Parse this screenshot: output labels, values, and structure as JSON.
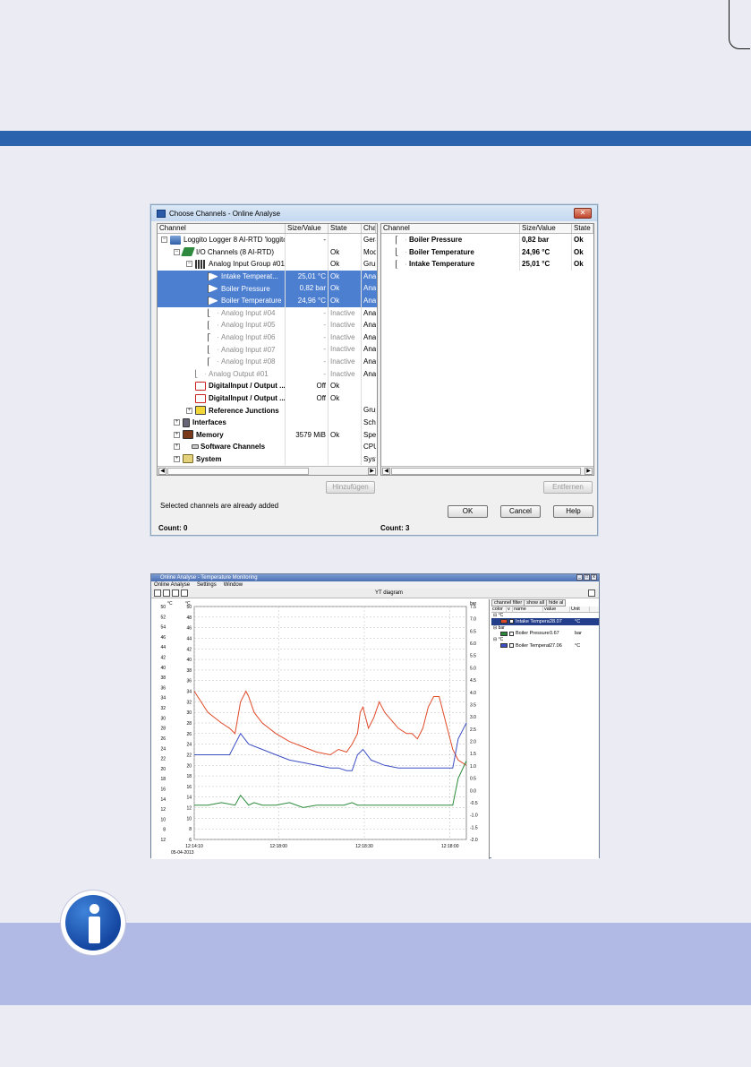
{
  "dialog": {
    "title": "Choose Channels - Online Analyse",
    "close_label": "✕",
    "left": {
      "headers": [
        "Channel",
        "Size/Value",
        "State",
        "Chan"
      ],
      "rows": [
        {
          "label": "Loggito Logger 8 AI-RTD 'loggito-l...",
          "value": "-",
          "state": "",
          "type": "Gerä",
          "indent": 0,
          "icon": "module-icon",
          "exp": "⊟"
        },
        {
          "label": "I/O Channels (8 AI-RTD)",
          "value": "",
          "state": "Ok",
          "type": "Mod",
          "indent": 1,
          "icon": "io-channels-icon",
          "exp": "⊟"
        },
        {
          "label": "Analog Input Group #01",
          "value": "",
          "state": "Ok",
          "type": "Grup",
          "indent": 2,
          "icon": "input-group-icon",
          "exp": "⊟"
        },
        {
          "label": "Intake Temperat...",
          "value": "25,01 °C",
          "state": "Ok",
          "type": "Anal",
          "indent": 3,
          "icon": "analog-input-icon",
          "sel": true
        },
        {
          "label": "Boiler Pressure",
          "value": "0,82 bar",
          "state": "Ok",
          "type": "Anal",
          "indent": 3,
          "icon": "analog-input-icon",
          "sel": true
        },
        {
          "label": "Boiler Temperature",
          "value": "24,96 °C",
          "state": "Ok",
          "type": "Anal",
          "indent": 3,
          "icon": "analog-input-icon",
          "sel": true
        },
        {
          "label": "Analog Input #04",
          "value": "-",
          "state": "Inactive",
          "type": "Anal",
          "indent": 3,
          "icon": "analog-input-icon",
          "gray": true
        },
        {
          "label": "Analog Input #05",
          "value": "-",
          "state": "Inactive",
          "type": "Anal",
          "indent": 3,
          "icon": "analog-input-icon",
          "gray": true
        },
        {
          "label": "Analog Input #06",
          "value": "-",
          "state": "Inactive",
          "type": "Anal",
          "indent": 3,
          "icon": "analog-input-icon",
          "gray": true
        },
        {
          "label": "Analog Input #07",
          "value": "-",
          "state": "Inactive",
          "type": "Anal",
          "indent": 3,
          "icon": "analog-input-icon",
          "gray": true
        },
        {
          "label": "Analog Input #08",
          "value": "-",
          "state": "Inactive",
          "type": "Anal",
          "indent": 3,
          "icon": "analog-input-icon",
          "gray": true
        },
        {
          "label": "Analog Output #01",
          "value": "-",
          "state": "Inactive",
          "type": "Anal",
          "indent": 2,
          "icon": "analog-output-icon",
          "gray": true
        },
        {
          "label": "DigitalInput / Output ...",
          "value": "Off",
          "state": "Ok",
          "type": "",
          "indent": 2,
          "icon": "digital-io-icon",
          "bold": true
        },
        {
          "label": "DigitalInput / Output ...",
          "value": "Off",
          "state": "Ok",
          "type": "",
          "indent": 2,
          "icon": "digital-io-icon",
          "bold": true
        },
        {
          "label": "Reference Junctions",
          "value": "",
          "state": "",
          "type": "Grup",
          "indent": 2,
          "icon": "reference-junction-icon",
          "exp": "⊞",
          "bold": true
        },
        {
          "label": "Interfaces",
          "value": "",
          "state": "",
          "type": "Schr",
          "indent": 1,
          "icon": "interfaces-icon",
          "exp": "⊞",
          "bold": true
        },
        {
          "label": "Memory",
          "value": "3579 MiB",
          "state": "Ok",
          "type": "Spei",
          "indent": 1,
          "icon": "memory-icon",
          "exp": "⊞",
          "bold": true
        },
        {
          "label": "Software Channels",
          "value": "",
          "state": "",
          "type": "CPU",
          "indent": 1,
          "icon": "software-channels-icon",
          "exp": "⊞",
          "bold": true
        },
        {
          "label": "System",
          "value": "",
          "state": "",
          "type": "Syst",
          "indent": 1,
          "icon": "system-icon",
          "exp": "⊞",
          "bold": true
        }
      ],
      "add_button": "Hinzufügen",
      "status": "Selected channels are already added",
      "count": "Count: 0"
    },
    "right": {
      "headers": [
        "Channel",
        "Size/Value",
        "State"
      ],
      "rows": [
        {
          "label": "Boiler Pressure",
          "value": "0,82 bar",
          "state": "Ok"
        },
        {
          "label": "Boiler Temperature",
          "value": "24,96 °C",
          "state": "Ok"
        },
        {
          "label": "Intake Temperature",
          "value": "25,01 °C",
          "state": "Ok"
        }
      ],
      "remove_button": "Entfernen",
      "count": "Count: 3"
    },
    "buttons": {
      "ok": "OK",
      "cancel": "Cancel",
      "help": "Help"
    }
  },
  "window": {
    "title": "Online Analyse - Temperature Monitoring",
    "menu": [
      "Online Analyse",
      "Settings",
      "Window"
    ],
    "diagram_title": "YT diagram",
    "side_tabs": [
      "channel filter",
      "show all",
      "hide al"
    ],
    "side_headers": [
      "color",
      "v",
      "name",
      "value",
      "Unit"
    ],
    "side_groups": [
      {
        "unit": "°C",
        "rows": [
          {
            "name": "Intake Temperature",
            "value": "28.07",
            "unit": "°C",
            "color": "#e04a2a",
            "sel": true
          }
        ]
      },
      {
        "unit": "bar",
        "rows": [
          {
            "name": "Boiler Pressure",
            "value": "0.67",
            "unit": "bar",
            "color": "#2a8a3a"
          }
        ]
      },
      {
        "unit": "°C",
        "rows": [
          {
            "name": "Boiler Temperature",
            "value": "27.06",
            "unit": "°C",
            "color": "#3d4fc4"
          }
        ]
      }
    ],
    "axis_units": {
      "left_outer": "°C",
      "left_inner": "°C",
      "right": "bar"
    },
    "date_label": "05-04-2013"
  },
  "chart_data": {
    "type": "line",
    "x_ticks": [
      "12:14:10",
      "12:18:00",
      "12:18:30",
      "12:18:00"
    ],
    "y_left_outer_ticks": [
      "50",
      "52",
      "54",
      "46",
      "44",
      "42",
      "40",
      "38",
      "36",
      "34",
      "32",
      "30",
      "28",
      "26",
      "24",
      "22",
      "20",
      "18",
      "16",
      "14",
      "12",
      "10",
      "8",
      "12"
    ],
    "y_left_inner_ticks": [
      "50",
      "48",
      "46",
      "44",
      "42",
      "40",
      "38",
      "36",
      "34",
      "32",
      "30",
      "28",
      "26",
      "24",
      "22",
      "20",
      "18",
      "16",
      "14",
      "12",
      "10",
      "8",
      "6"
    ],
    "y_right_ticks": [
      "7.5",
      "7.0",
      "6.5",
      "6.0",
      "5.5",
      "5.0",
      "4.5",
      "4.0",
      "3.5",
      "3.0",
      "2.5",
      "2.0",
      "1.5",
      "1.0",
      "0.5",
      "0.0",
      "-0.5",
      "-1.0",
      "-1.5",
      "-2.0"
    ],
    "ylim_left": [
      6,
      50
    ],
    "ylim_right": [
      -2.0,
      7.5
    ],
    "series": [
      {
        "name": "Intake Temperature",
        "color": "#e04a2a",
        "axis": "left",
        "x": [
          0,
          0.05,
          0.1,
          0.13,
          0.15,
          0.17,
          0.19,
          0.2,
          0.22,
          0.25,
          0.3,
          0.35,
          0.4,
          0.45,
          0.5,
          0.53,
          0.56,
          0.58,
          0.6,
          0.61,
          0.62,
          0.64,
          0.66,
          0.68,
          0.7,
          0.75,
          0.78,
          0.8,
          0.82,
          0.84,
          0.86,
          0.88,
          0.9,
          0.93,
          0.95,
          0.97,
          1.0
        ],
        "y": [
          34,
          30,
          28,
          27,
          26,
          32,
          34,
          33,
          30,
          28,
          26,
          24.5,
          23.5,
          22.5,
          22,
          23,
          22.5,
          24,
          26,
          30,
          31,
          27,
          29,
          32,
          30,
          27,
          26,
          26,
          25,
          27,
          31,
          33,
          33,
          27,
          23,
          21,
          20
        ]
      },
      {
        "name": "Boiler Temperature",
        "color": "#3d4fc4",
        "axis": "left",
        "x": [
          0,
          0.05,
          0.1,
          0.13,
          0.15,
          0.17,
          0.2,
          0.25,
          0.3,
          0.35,
          0.4,
          0.45,
          0.5,
          0.53,
          0.56,
          0.58,
          0.6,
          0.62,
          0.65,
          0.7,
          0.75,
          0.8,
          0.85,
          0.88,
          0.9,
          0.93,
          0.95,
          0.97,
          1.0
        ],
        "y": [
          22,
          22,
          22,
          22,
          24,
          26,
          24,
          23,
          22,
          21,
          20.5,
          20,
          19.5,
          19.5,
          19,
          19,
          22,
          23,
          21,
          20,
          19.5,
          19.5,
          19.5,
          19.5,
          19.5,
          19.5,
          19.5,
          25,
          28
        ]
      },
      {
        "name": "Boiler Pressure",
        "color": "#2a8a3a",
        "axis": "right",
        "x": [
          0,
          0.05,
          0.1,
          0.15,
          0.17,
          0.2,
          0.22,
          0.25,
          0.3,
          0.35,
          0.4,
          0.45,
          0.5,
          0.55,
          0.58,
          0.6,
          0.62,
          0.65,
          0.7,
          0.75,
          0.8,
          0.85,
          0.88,
          0.9,
          0.95,
          0.97,
          1.0
        ],
        "y": [
          -0.6,
          -0.6,
          -0.5,
          -0.6,
          -0.2,
          -0.6,
          -0.5,
          -0.6,
          -0.6,
          -0.5,
          -0.7,
          -0.6,
          -0.6,
          -0.6,
          -0.5,
          -0.6,
          -0.6,
          -0.6,
          -0.6,
          -0.6,
          -0.6,
          -0.6,
          -0.6,
          -0.6,
          -0.6,
          0.5,
          1.2
        ]
      }
    ],
    "grid": true
  }
}
